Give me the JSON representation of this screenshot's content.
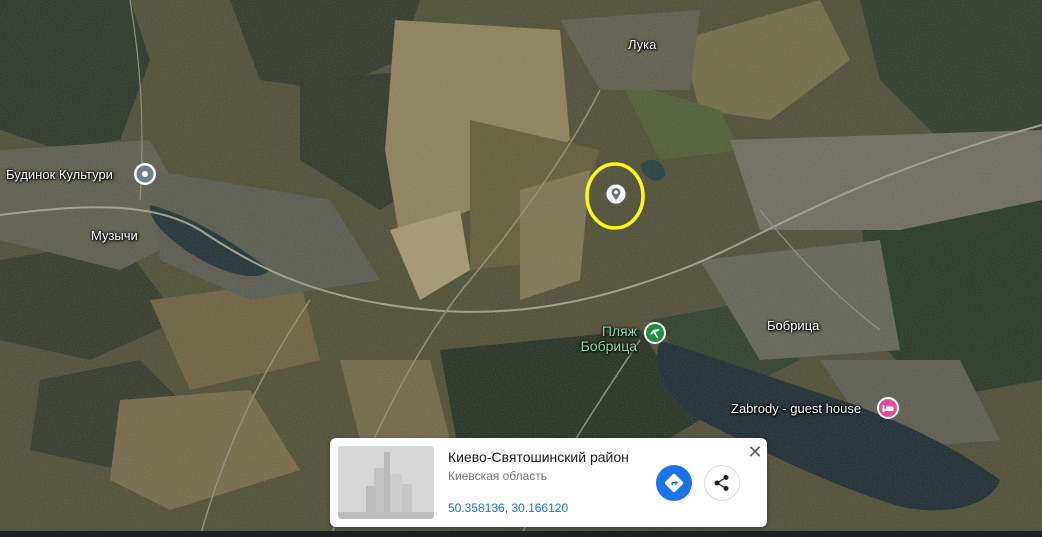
{
  "map": {
    "places": [
      {
        "name": "Лука"
      },
      {
        "name": "Будинок Культури"
      },
      {
        "name": "Музычи"
      },
      {
        "name": "Бобрица"
      },
      {
        "name": "Zabrody - guest house"
      }
    ],
    "beach": {
      "line1": "Пляж",
      "line2": "Бобрица"
    }
  },
  "card": {
    "title": "Киево-Святошинский район",
    "subtitle": "Киевская область",
    "coords": "50.358136, 30.166120",
    "close_glyph": "✕"
  },
  "icons": {
    "dropped_pin": "location-pin-icon",
    "culture_pin": "location-pin-icon",
    "beach_pin": "beach-icon",
    "hotel_pin": "hotel-bed-icon",
    "directions": "directions-icon",
    "share": "share-icon",
    "close": "close-icon"
  },
  "colors": {
    "highlight_ring": "#ffff00",
    "directions_blue": "#1a73e8",
    "beach_green": "#1e8e3e",
    "hotel_pink": "#e04d9c"
  }
}
